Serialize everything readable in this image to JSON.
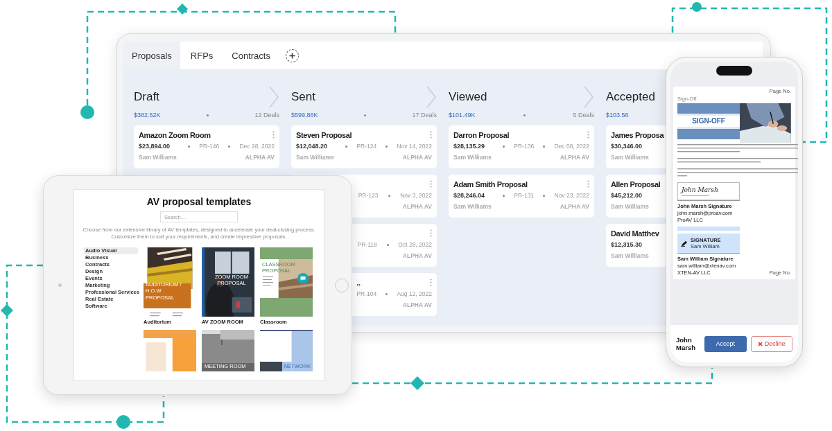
{
  "board": {
    "tabs": [
      {
        "label": "Proposals",
        "selected": true
      },
      {
        "label": "RFPs",
        "selected": false
      },
      {
        "label": "Contracts",
        "selected": false
      }
    ],
    "columns": [
      {
        "title": "Draft",
        "total": "$382.52K",
        "deals": "12 Deals",
        "cards": [
          {
            "title": "Amazon Zoom Room",
            "amount": "$23,894.00",
            "pr": "PR-146",
            "date": "Dec 28, 2022",
            "owner": "Sam Williams",
            "company": "ALPHA AV",
            "menu": true
          }
        ]
      },
      {
        "title": "Sent",
        "total": "$599.88K",
        "deals": "17 Deals",
        "cards": [
          {
            "title": "Steven Proposal",
            "amount": "$12,048.20",
            "pr": "PR-124",
            "date": "Nov 14, 2022",
            "owner": "Sam Williams",
            "company": "ALPHA AV",
            "menu": true
          },
          {
            "pr": "PR-123",
            "date": "Nov 3, 2022",
            "company": "ALPHA AV",
            "menu": true
          },
          {
            "pr": "PR-118",
            "date": "Oct 28, 2022",
            "company": "ALPHA AV",
            "menu": true
          },
          {
            "title": "..",
            "pr": "PR-104",
            "date": "Aug 12, 2022",
            "company": "ALPHA AV",
            "menu": true
          }
        ]
      },
      {
        "title": "Viewed",
        "total": "$101.49K",
        "deals": "5 Deals",
        "cards": [
          {
            "title": "Darron Proposal",
            "amount": "$28,135.29",
            "pr": "PR-136",
            "date": "Dec 08, 2022",
            "owner": "Sam Williams",
            "company": "ALPHA AV",
            "menu": true
          },
          {
            "title": "Adam Smith Proposal",
            "amount": "$28,246.04",
            "pr": "PR-131",
            "date": "Nov 23, 2022",
            "owner": "Sam Williams",
            "company": "ALPHA AV",
            "menu": true
          }
        ]
      },
      {
        "title": "Accepted",
        "total": "$103.56",
        "cards": [
          {
            "title": "James Proposa",
            "amount": "$30,346.00",
            "owner": "Sam Williams",
            "menu": false
          },
          {
            "title": "Allen Proposal",
            "amount": "$45,212.00",
            "owner": "Sam Williams",
            "menu": false
          },
          {
            "title": "David Matthev",
            "amount": "$12,315.30",
            "owner": "Sam Williams",
            "menu": false
          }
        ]
      }
    ]
  },
  "tablet": {
    "title": "AV proposal templates",
    "search": {
      "placeholder": "Search..."
    },
    "description": "Choose from our extensive library of AV templates, designed to accelerate your deal-closing process. Customize them to suit your requirements, and create impressive proposals.",
    "categories": [
      {
        "label": "Audio Visual",
        "selected": true
      },
      {
        "label": "Business",
        "selected": false
      },
      {
        "label": "Contracts",
        "selected": false
      },
      {
        "label": "Design",
        "selected": false
      },
      {
        "label": "Events",
        "selected": false
      },
      {
        "label": "Marketing",
        "selected": false
      },
      {
        "label": "Professional Services",
        "selected": false
      },
      {
        "label": "Real Estate",
        "selected": false
      },
      {
        "label": "Software",
        "selected": false
      }
    ],
    "templates": [
      {
        "label": "Auditorium",
        "cover_title": "AUDITORIUM / H.O.W PROPOSAL",
        "kind": "band"
      },
      {
        "label": "AV ZOOM ROOM",
        "cover_title": "ZOOM ROOM PROPOSAL",
        "kind": "box"
      },
      {
        "label": "Classroom",
        "cover_title": "CLASSROOM PROPOSAL",
        "kind": "frame"
      },
      {
        "kind": "block"
      },
      {
        "cover_title": "MEETING ROOM",
        "kind": "strip"
      },
      {
        "cover_title": "NETWORK",
        "kind": "panel"
      }
    ]
  },
  "phone": {
    "document": {
      "page_label": "Page No.",
      "section_label": "Sign-Off",
      "banner_title": "SIGN-OFF",
      "signers": [
        {
          "kind": "handwritten",
          "signature": "John Marsh",
          "caption": "John Marsh Signature",
          "email": "john.marsh@proav.com",
          "company": "ProAV LLC"
        },
        {
          "kind": "stamp",
          "stamp_label": "SIGNATURE",
          "signature": "Sam William",
          "caption": "Sam William Signature",
          "email": "sam.william@xtenav.com",
          "company": "XTEN-AV LLC"
        }
      ],
      "footer_label": "Page No."
    },
    "signer_name": "John Marsh",
    "actions": [
      {
        "label": "Accept",
        "kind": "primary"
      },
      {
        "label": "Decline",
        "kind": "danger"
      }
    ]
  }
}
